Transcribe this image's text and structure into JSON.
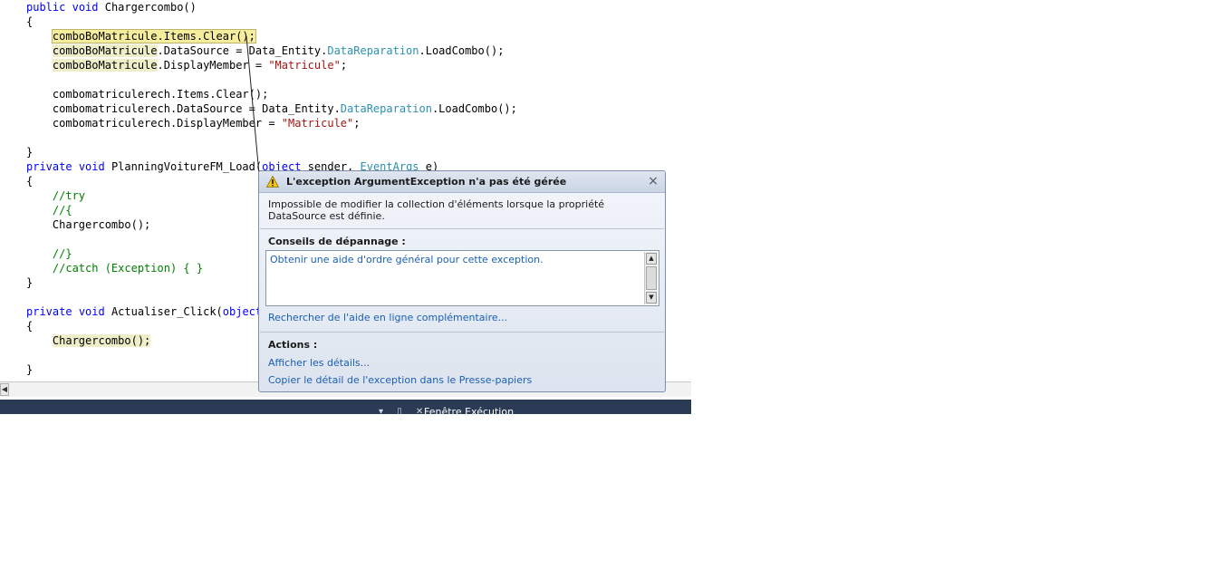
{
  "code": {
    "l1_kw1": "public",
    "l1_kw2": "void",
    "l1_name": " Chargercombo()",
    "l2": "{",
    "l3_a": "comboBoMatricule",
    "l3_b": ".Items.Clear();",
    "l4_a": "comboBoMatricule",
    "l4_b": ".DataSource = Data_Entity.",
    "l4_type": "DataReparation",
    "l4_c": ".LoadCombo();",
    "l5_a": "comboBoMatricule",
    "l5_b": ".DisplayMember = ",
    "l5_str": "\"Matricule\"",
    "l5_c": ";",
    "l7": "combomatriculerech.Items.Clear();",
    "l8_a": "combomatriculerech.DataSource = Data_Entity.",
    "l8_type": "DataReparation",
    "l8_c": ".LoadCombo();",
    "l9_a": "combomatriculerech.DisplayMember = ",
    "l9_str": "\"Matricule\"",
    "l9_c": ";",
    "l11": "}",
    "l12_kw1": "private",
    "l12_kw2": "void",
    "l12_name": " PlanningVoitureFM_Load(",
    "l12_kw3": "object",
    "l12_param": " sender, ",
    "l12_type": "EventArgs",
    "l12_e": " e)",
    "l13": "{",
    "l14": "//try",
    "l15": "//{",
    "l16": "Chargercombo();",
    "l18": "//}",
    "l19": "//catch (Exception) { }",
    "l20": "}",
    "l22_kw1": "private",
    "l22_kw2": "void",
    "l22_name": " Actualiser_Click(",
    "l22_kw3": "object",
    "l23": "{",
    "l24": "Chargercombo();",
    "l26": "}"
  },
  "bottom_bar": {
    "icons": "▾ ▯ ✕",
    "title": "Fenêtre Exécution"
  },
  "popup": {
    "title": "L'exception ArgumentException n'a pas été gérée",
    "icon": "warning-icon",
    "close_label": "×",
    "message": "Impossible de modifier la collection d'éléments lorsque la propriété DataSource est définie.",
    "tips_heading": "Conseils de dépannage :",
    "tips_items": [
      "Obtenir une aide d'ordre général pour cette exception."
    ],
    "online_help_link": "Rechercher de l'aide en ligne complémentaire...",
    "actions_heading": "Actions :",
    "actions": [
      "Afficher les détails...",
      "Copier le détail de l'exception dans le Presse-papiers"
    ]
  },
  "colors": {
    "keyword": "#0000ff",
    "type": "#2b91af",
    "string": "#a31515",
    "comment": "#008000",
    "link": "#1a5fb4",
    "bottom_bar": "#2b3a55"
  }
}
